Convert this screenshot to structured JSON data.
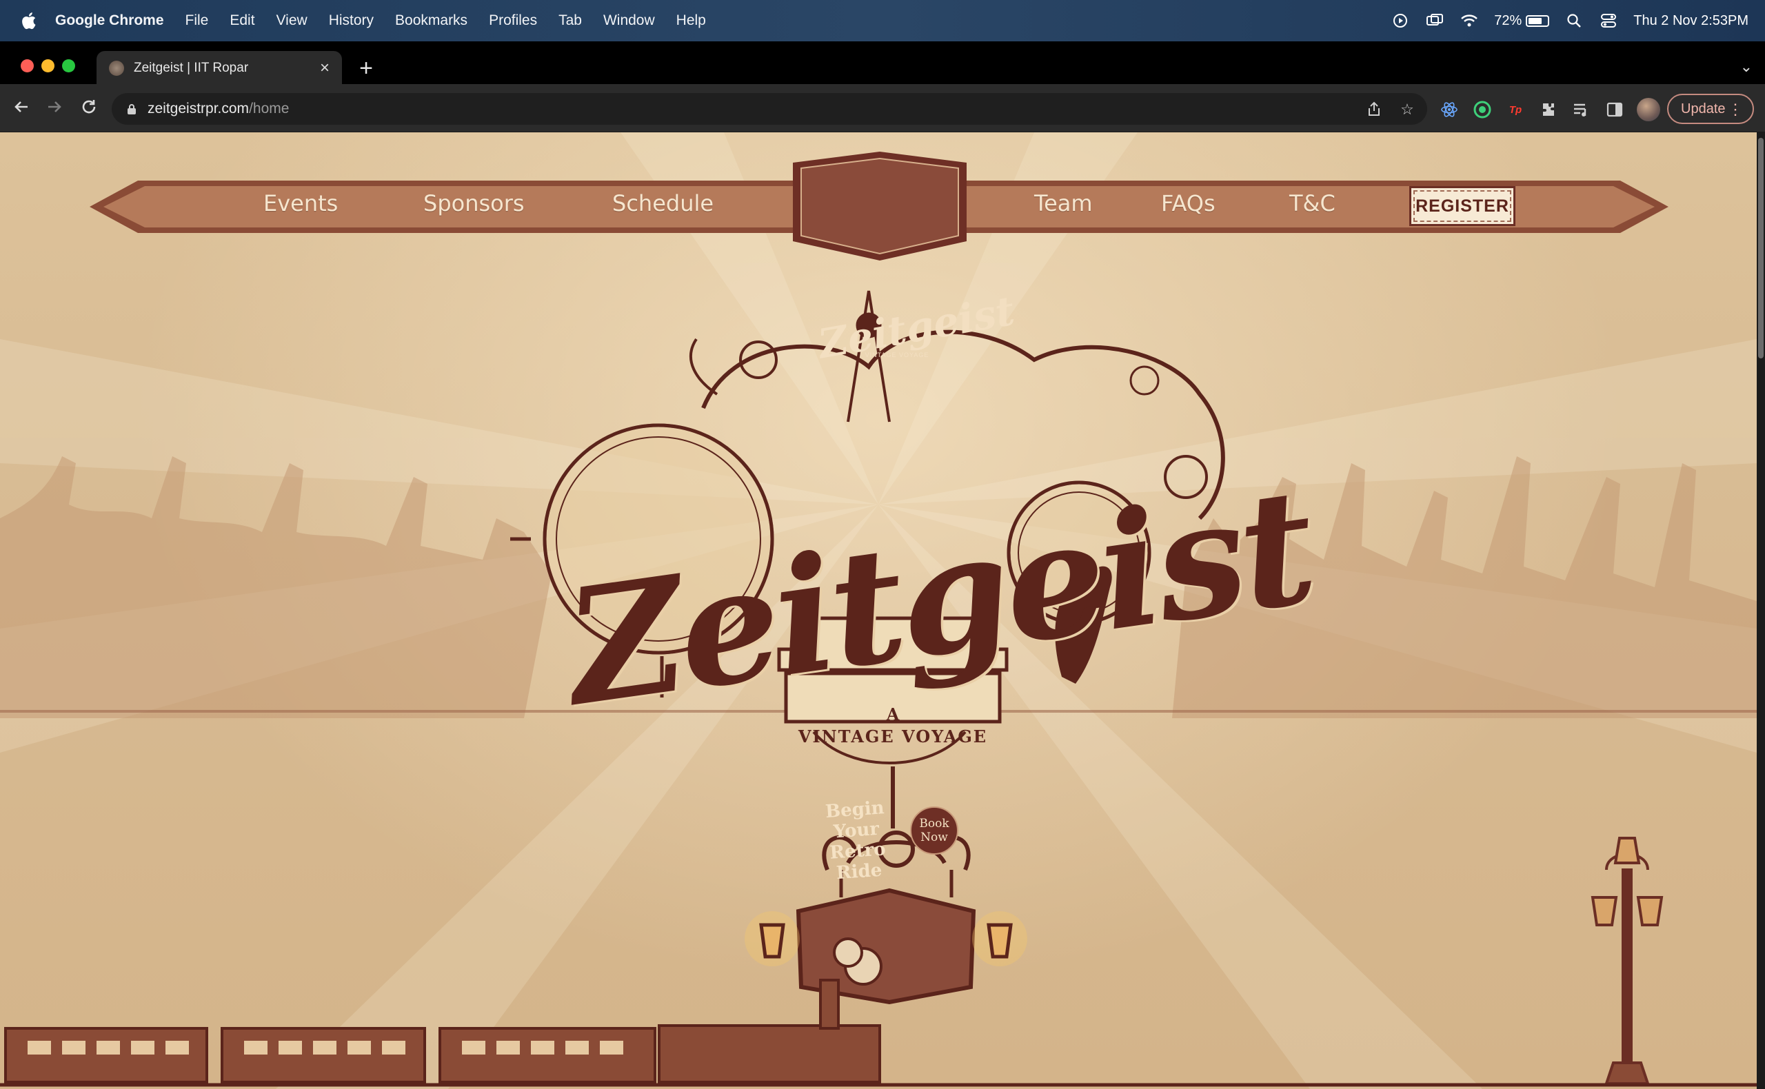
{
  "menubar": {
    "app_name": "Google Chrome",
    "items": [
      "File",
      "Edit",
      "View",
      "History",
      "Bookmarks",
      "Profiles",
      "Tab",
      "Window",
      "Help"
    ],
    "battery_percent": "72%",
    "battery_level": 0.72,
    "datetime": "Thu 2 Nov  2:53PM"
  },
  "browser": {
    "tab_title": "Zeitgeist | IIT Ropar",
    "url_host": "zeitgeistrpr.com",
    "url_path": "/home",
    "update_label": "Update",
    "extension_tp_label": "Tp"
  },
  "site": {
    "nav_left": [
      "Events",
      "Sponsors",
      "Schedule"
    ],
    "nav_right": [
      "Team",
      "FAQs",
      "T&C"
    ],
    "register_label": "REGISTER",
    "logo_word": "Zeitgeist",
    "badge_sub": "VINTAGE VOYAGE",
    "tagline_a": "A",
    "tagline": "VINTAGE VOYAGE",
    "sign_text": "Begin Your Retro Ride",
    "book_now": "Book Now"
  },
  "colors": {
    "parchment": "#d8bb93",
    "maroon": "#6b2e24",
    "nav_bar": "#b57a5a",
    "menubar": "#233f60",
    "chrome_dark": "#2b2b2b"
  }
}
